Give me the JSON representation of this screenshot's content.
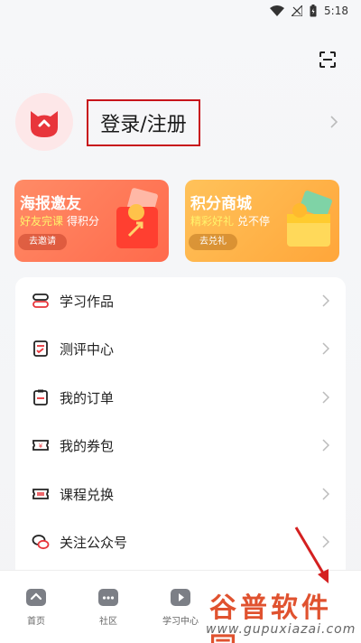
{
  "status_bar": {
    "time": "5:18"
  },
  "profile": {
    "login_label": "登录/注册"
  },
  "promos": [
    {
      "title": "海报邀友",
      "highlight": "好友完课",
      "subtitle": "得积分",
      "cta": "去邀请"
    },
    {
      "title": "积分商城",
      "highlight": "精彩好礼",
      "subtitle": "兑不停",
      "cta": "去兑礼"
    }
  ],
  "menu": {
    "items": [
      {
        "label": "学习作品",
        "icon": "works-icon"
      },
      {
        "label": "测评中心",
        "icon": "assessment-icon"
      },
      {
        "label": "我的订单",
        "icon": "orders-icon"
      },
      {
        "label": "我的券包",
        "icon": "coupon-icon"
      },
      {
        "label": "课程兑换",
        "icon": "exchange-icon"
      },
      {
        "label": "关注公众号",
        "icon": "wechat-icon"
      }
    ]
  },
  "tabbar": {
    "tabs": [
      {
        "label": "首页"
      },
      {
        "label": "社区"
      },
      {
        "label": "学习中心"
      }
    ]
  },
  "watermark": {
    "text": "谷普软件园",
    "url": "www.gupuxiazai.com"
  },
  "colors": {
    "accent": "#e8353b",
    "promo_left": "#ff6f50",
    "promo_right": "#ffab40",
    "highlight_box": "#c8141b"
  }
}
